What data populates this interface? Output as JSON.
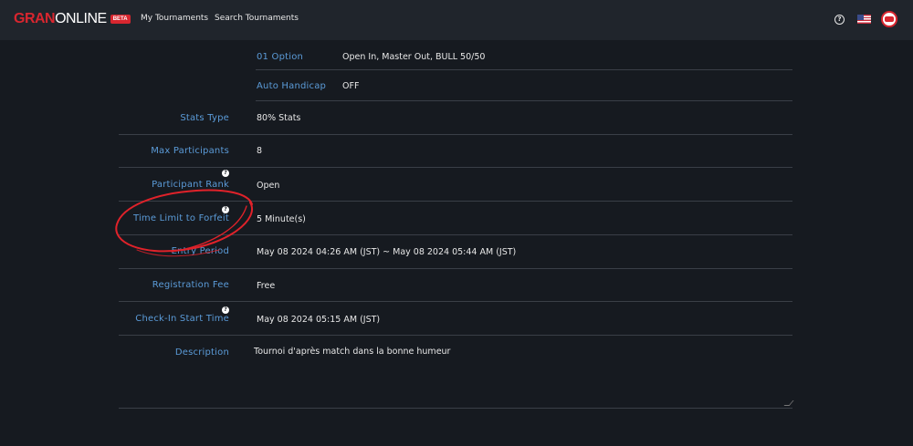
{
  "header": {
    "logo_primary": "GRAN",
    "logo_secondary": "ONLINE",
    "logo_badge": "BETA",
    "nav": [
      "My Tournaments",
      "Search Tournaments"
    ],
    "help_glyph": "?"
  },
  "settings": {
    "sub_rows": [
      {
        "label": "01 Option",
        "value": "Open In, Master Out, BULL 50/50"
      },
      {
        "label": "Auto Handicap",
        "value": "OFF"
      }
    ],
    "rows": [
      {
        "label": "Stats Type",
        "value": "80% Stats"
      },
      {
        "label": "Max Participants",
        "value": "8"
      },
      {
        "label": "Participant Rank",
        "value": "Open"
      },
      {
        "label": "Time Limit to Forfeit",
        "value": "5 Minute(s)"
      },
      {
        "label": "Entry Period",
        "value": "May 08 2024 04:26 AM (JST) ~ May 08 2024 05:44 AM (JST)"
      },
      {
        "label": "Registration Fee",
        "value": "Free"
      },
      {
        "label": "Check-In Start Time",
        "value": "May 08 2024 05:15 AM (JST)"
      }
    ],
    "description_label": "Description",
    "description_value": "Tournoi d'après match dans la bonne humeur",
    "info_glyph": "?"
  },
  "colors": {
    "background": "#161a20",
    "header_bg": "#20252c",
    "label_blue": "#5b9bd8",
    "brand_red": "#d8262f",
    "annotation_red": "#e0222a"
  }
}
